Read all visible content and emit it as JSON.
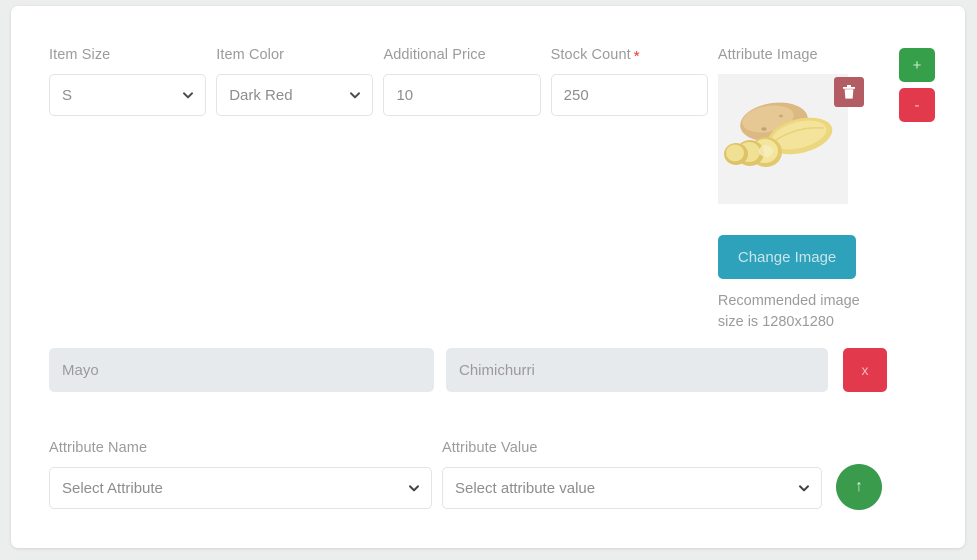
{
  "variant_row": {
    "item_size": {
      "label": "Item Size",
      "value": "S",
      "icon": "chevron-down-icon"
    },
    "item_color": {
      "label": "Item Color",
      "value": "Dark Red",
      "icon": "chevron-down-icon"
    },
    "additional_price": {
      "label": "Additional Price",
      "value": "10",
      "placeholder": "Additional Price"
    },
    "stock_count": {
      "label": "Stock Count",
      "required_marker": "*",
      "value": "250",
      "placeholder": "Stock Count"
    },
    "attribute_image": {
      "label": "Attribute Image",
      "delete_icon": "trash-icon",
      "image_alt": "potato-thumbnail",
      "change_button": "Change Image",
      "recommendation": "Recommended image size is 1280x1280"
    }
  },
  "row_controls": {
    "add_label": "+",
    "remove_label": "-"
  },
  "attribute_pair": {
    "name_value": "Mayo",
    "value_value": "Chimichurri",
    "remove_label": "x"
  },
  "attribute_picker": {
    "name": {
      "label": "Attribute Name",
      "value": "Select Attribute",
      "icon": "chevron-down-icon"
    },
    "value": {
      "label": "Attribute Value",
      "value": "Select attribute value",
      "icon": "chevron-down-icon"
    },
    "submit_label": "↑"
  },
  "colors": {
    "teal": "#2da2ba",
    "green": "#35a049",
    "red": "#e23a4c",
    "delete_red": "#b35c63",
    "required": "#f0392b",
    "label": "#9b9b9e"
  }
}
